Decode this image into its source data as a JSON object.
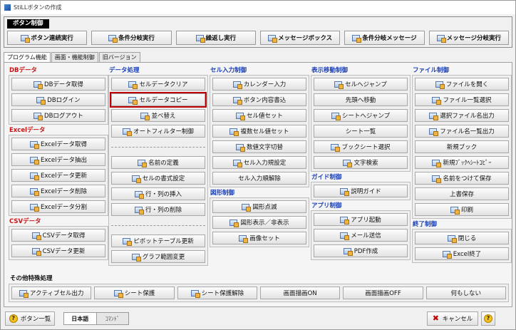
{
  "window": {
    "title": "StiLLボタンの作成"
  },
  "control_group": {
    "label": "ボタン制御",
    "buttons": [
      "ボタン連続実行",
      "条件分岐実行",
      "繰返し実行",
      "メッセージボックス",
      "条件分岐メッセージ",
      "メッセージ分岐実行"
    ]
  },
  "tabs": [
    "プログラム機能",
    "画面・機能制御",
    "旧バージョン"
  ],
  "sections": {
    "db": {
      "title": "DBデータ",
      "buttons": [
        "DBデータ取得",
        "DBログイン",
        "DBログアウト"
      ]
    },
    "excel": {
      "title": "Excelデータ",
      "buttons": [
        "Excelデータ取得",
        "Excelデータ抽出",
        "Excelデータ更新",
        "Excelデータ削除",
        "Excelデータ分割"
      ]
    },
    "csv": {
      "title": "CSVデータ",
      "buttons": [
        "CSVデータ取得",
        "CSVデータ更新"
      ]
    },
    "data": {
      "title": "データ処理",
      "buttons": [
        "セルデータクリア",
        "セルデータコピー",
        "並べ替え",
        "オートフィルター制御",
        "名前の定義",
        "セルの書式設定",
        "行・列の挿入",
        "行・列の削除",
        "ピボットテーブル更新",
        "グラフ範囲変更"
      ]
    },
    "cell_input": {
      "title": "セル入力制御",
      "buttons": [
        "カレンダー入力",
        "ボタン内容書込",
        "セル値セット",
        "複数セル値セット",
        "数値文字切替",
        "セル入力規設定",
        "セル入力順解除"
      ]
    },
    "shape": {
      "title": "図形制御",
      "buttons": [
        "図形点滅",
        "図形表示／非表示",
        "画像セット"
      ]
    },
    "nav": {
      "title": "表示移動制御",
      "buttons": [
        "セルへジャンプ",
        "先頭へ移動",
        "シートへジャンプ",
        "シート一覧",
        "ブックシート選択",
        "文字検索"
      ]
    },
    "guide": {
      "title": "ガイド制御",
      "buttons": [
        "説明ガイド"
      ]
    },
    "app": {
      "title": "アプリ制御",
      "buttons": [
        "アプリ起動",
        "メール送信",
        "PDF作成"
      ]
    },
    "file": {
      "title": "ファイル制御",
      "buttons": [
        "ファイルを開く",
        "ファイル一覧選択",
        "選択ファイル名出力",
        "ファイル名一覧出力",
        "新規ブック",
        "新規ﾌﾞｯｸﾍｼｰﾄｺﾋﾟｰ",
        "名前をつけて保存",
        "上書保存",
        "印刷"
      ]
    },
    "end": {
      "title": "終了制御",
      "buttons": [
        "閉じる",
        "Excel終了"
      ]
    },
    "other": {
      "title": "その他特殊処理",
      "buttons": [
        "アクティブセル出力",
        "シート保護",
        "シート保護解除",
        "画面描画ON",
        "画面描画OFF",
        "何もしない"
      ]
    }
  },
  "bottom": {
    "list_button": "ボタン一覧",
    "lang_on": "日本語",
    "lang_off": "ｺﾏﾝﾄﾞ",
    "cancel": "キャンセル",
    "help": "?"
  }
}
